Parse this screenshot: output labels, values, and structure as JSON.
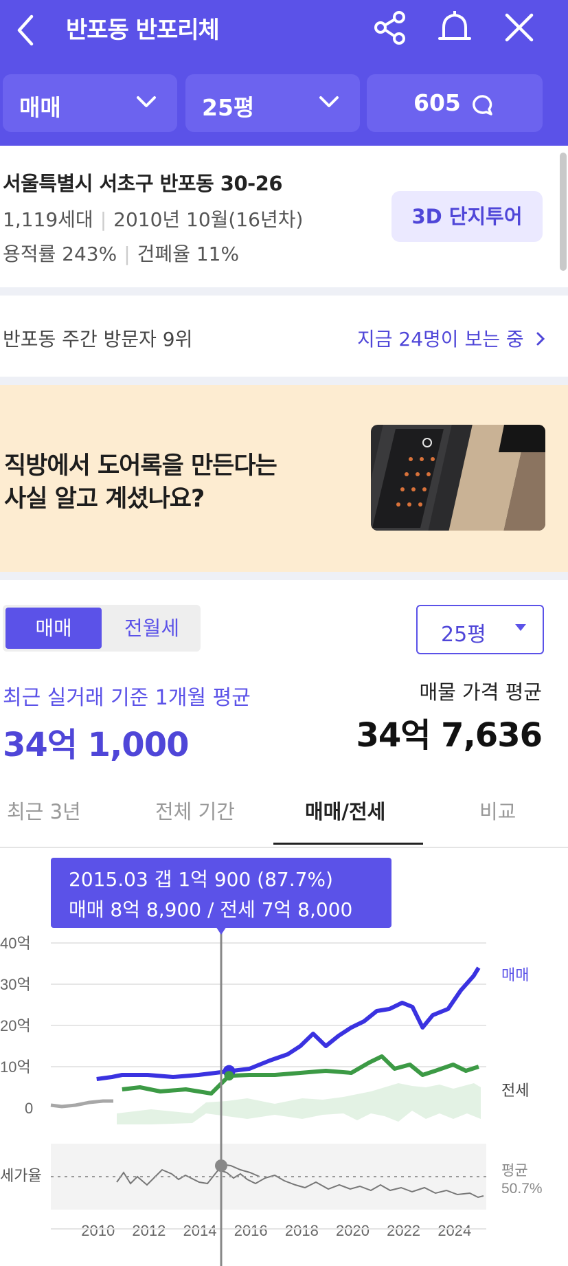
{
  "header": {
    "title": "반포동 반포리체",
    "filters": [
      {
        "label": "매매"
      },
      {
        "label": "25평"
      },
      {
        "label": "605"
      }
    ]
  },
  "complex": {
    "address": "서울특별시 서초구 반포동 30-26",
    "households": "1,119세대",
    "built": "2010년 10월(16년차)",
    "far": "용적률 243%",
    "bcr": "건폐율 11%",
    "tour_button": "3D 단지투어"
  },
  "visitors": {
    "rank": "반포동 주간 방문자 9위",
    "now_viewing": "지금 24명이 보는 중"
  },
  "ad": {
    "line1": "직방에서 도어록을 만든다는",
    "line2": "사실 알고 계셨나요?"
  },
  "price": {
    "segments": [
      "매매",
      "전월세"
    ],
    "pyeong": "25평",
    "avg_label": "최근 실거래 기준 1개월 평균",
    "avg_value": "34억 1,000",
    "listing_label": "매물 가격 평균",
    "listing_value": "34억 7,636"
  },
  "tabs": [
    "최근 3년",
    "전체 기간",
    "매매/전세",
    "비교"
  ],
  "tooltip": {
    "line1": "2015.03  갭 1억 900 (87.7%)",
    "line2": "매매 8억 8,900 / 전세 7억 8,000"
  },
  "colors": {
    "primary": "#5b52e8",
    "sale": "#3a32e0",
    "jeonse": "#3c9a45",
    "ratio": "#666666"
  },
  "chart_data": {
    "type": "line",
    "ylabel_ticks": [
      "40억",
      "30억",
      "20억",
      "10억",
      "0"
    ],
    "ratio_axis_label": "세가율",
    "ratio_avg_label": "평균",
    "ratio_avg_value": "50.7%",
    "x_ticks": [
      "2010",
      "2012",
      "2014",
      "2016",
      "2018",
      "2020",
      "2022",
      "2024"
    ],
    "ylim": [
      0,
      40
    ],
    "series": [
      {
        "name": "매매",
        "unit": "억",
        "x": [
          2010.0,
          2010.6,
          2011.0,
          2012.0,
          2013.0,
          2014.0,
          2015.2,
          2016.0,
          2016.8,
          2017.5,
          2018.0,
          2018.5,
          2019.0,
          2019.5,
          2020.0,
          2020.5,
          2021.0,
          2021.5,
          2022.0,
          2022.4,
          2022.8,
          2023.2,
          2023.8,
          2024.3,
          2024.8,
          2025.0
        ],
        "values": [
          7.0,
          7.5,
          8.0,
          8.0,
          7.5,
          8.0,
          8.9,
          9.5,
          11.5,
          13.0,
          15.0,
          18.0,
          15.0,
          17.5,
          19.5,
          21.0,
          23.5,
          24.0,
          25.5,
          24.5,
          19.5,
          22.5,
          24.0,
          28.5,
          32.0,
          34.0
        ]
      },
      {
        "name": "전세",
        "unit": "억",
        "x": [
          2011.0,
          2011.7,
          2012.5,
          2013.5,
          2014.5,
          2015.2,
          2016.0,
          2017.0,
          2018.0,
          2019.0,
          2020.0,
          2020.7,
          2021.2,
          2021.7,
          2022.3,
          2022.8,
          2023.3,
          2024.0,
          2024.5,
          2025.0
        ],
        "values": [
          4.5,
          5.0,
          4.0,
          4.5,
          3.5,
          7.8,
          8.0,
          8.0,
          8.5,
          9.0,
          8.5,
          11.0,
          12.5,
          9.5,
          10.5,
          8.0,
          9.0,
          10.5,
          9.0,
          10.0
        ]
      }
    ],
    "highlight": {
      "x": 2015.2,
      "sale": 8.89,
      "jeonse": 7.8
    }
  }
}
